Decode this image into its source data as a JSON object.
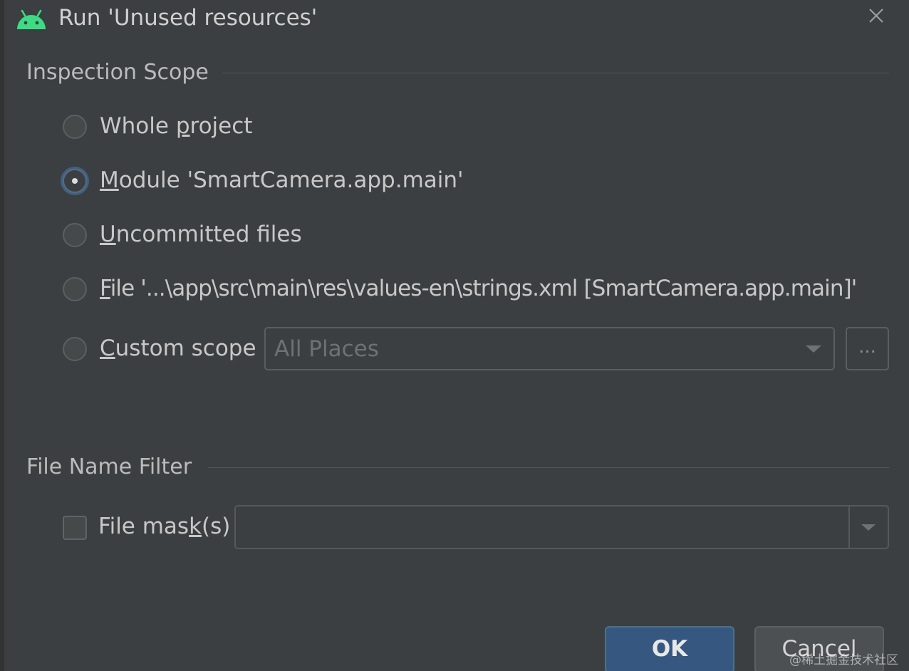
{
  "window": {
    "title": "Run 'Unused resources'",
    "app_icon": "android-icon",
    "close_icon": "close-icon"
  },
  "inspection_scope": {
    "title": "Inspection Scope",
    "options": [
      {
        "pre": "Whole ",
        "mnemonic": "p",
        "post": "roject",
        "selected": false
      },
      {
        "pre": "",
        "mnemonic": "M",
        "post": "odule 'SmartCamera.app.main'",
        "selected": true
      },
      {
        "pre": "",
        "mnemonic": "U",
        "post": "ncommitted files",
        "selected": false
      },
      {
        "pre": "",
        "mnemonic": "F",
        "post": "ile '...\\app\\src\\main\\res\\values-en\\strings.xml [SmartCamera.app.main]'",
        "selected": false
      },
      {
        "pre": "",
        "mnemonic": "C",
        "post": "ustom scope",
        "selected": false
      }
    ],
    "custom_scope_value": "All Places",
    "ellipsis_label": "..."
  },
  "file_name_filter": {
    "title": "File Name Filter",
    "mask_label_pre": "File mas",
    "mask_label_mnemonic": "k",
    "mask_label_post": "(s)",
    "mask_checked": false,
    "mask_value": ""
  },
  "buttons": {
    "ok": "OK",
    "cancel": "Cancel"
  },
  "watermark": "@稀土掘金技术社区",
  "colors": {
    "background": "#3c3f41",
    "accent": "#365880",
    "android_green": "#3ddc84"
  }
}
